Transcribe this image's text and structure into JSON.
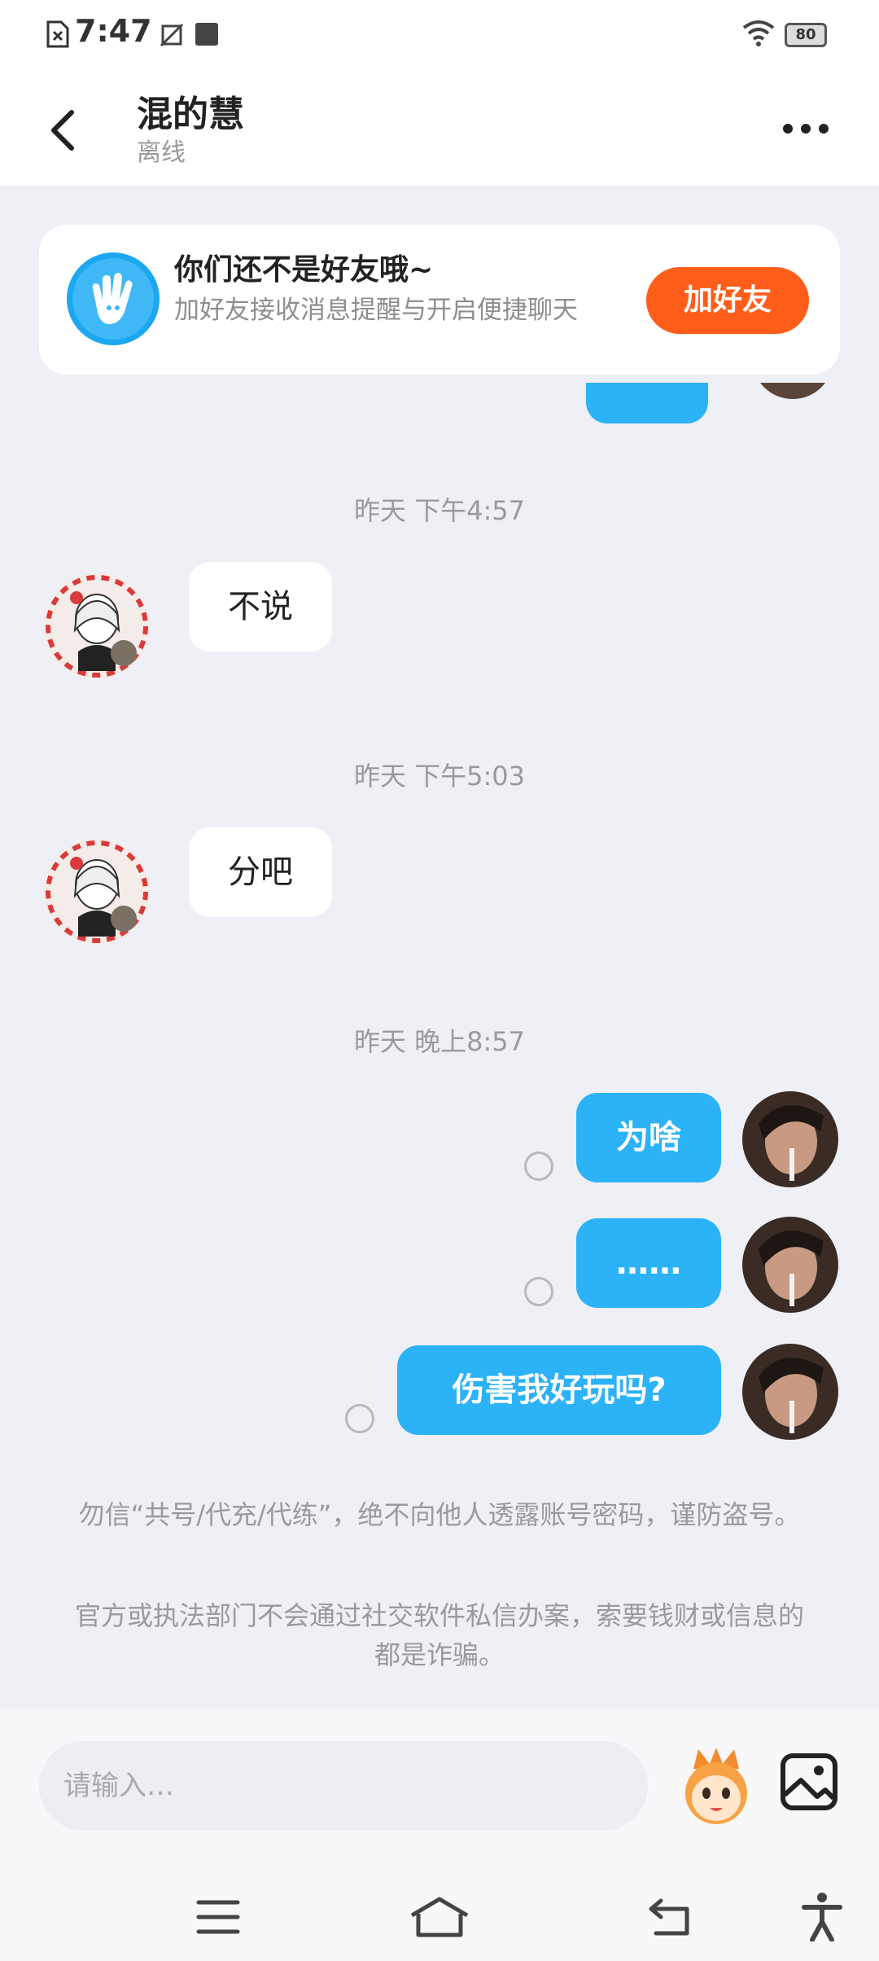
{
  "status_bar": {
    "time": "7:47",
    "battery": "80"
  },
  "header": {
    "title": "混的慧",
    "subtitle": "离线"
  },
  "banner": {
    "title": "你们还不是好友哦~",
    "description": "加好友接收消息提醒与开启便捷聊天",
    "button_label": "加好友"
  },
  "messages": [
    {
      "timestamp": "昨天 下午4:57",
      "side": "left",
      "text": "不说"
    },
    {
      "timestamp": "昨天 下午5:03",
      "side": "left",
      "text": "分吧"
    },
    {
      "timestamp": "昨天 晚上8:57",
      "side": "right",
      "text": "为啥"
    },
    {
      "side": "right",
      "text": "……"
    },
    {
      "side": "right",
      "text": "伤害我好玩吗?"
    }
  ],
  "notices": [
    "勿信“共号/代充/代练”，绝不向他人透露账号密码，谨防盗号。",
    "官方或执法部门不会通过社交软件私信办案，索要钱财或信息的都是诈骗。"
  ],
  "input": {
    "placeholder": "请输入…"
  },
  "colors": {
    "accent_blue": "#2cb2f7",
    "add_button": "#ff5e1a",
    "background": "#eef0f6"
  }
}
